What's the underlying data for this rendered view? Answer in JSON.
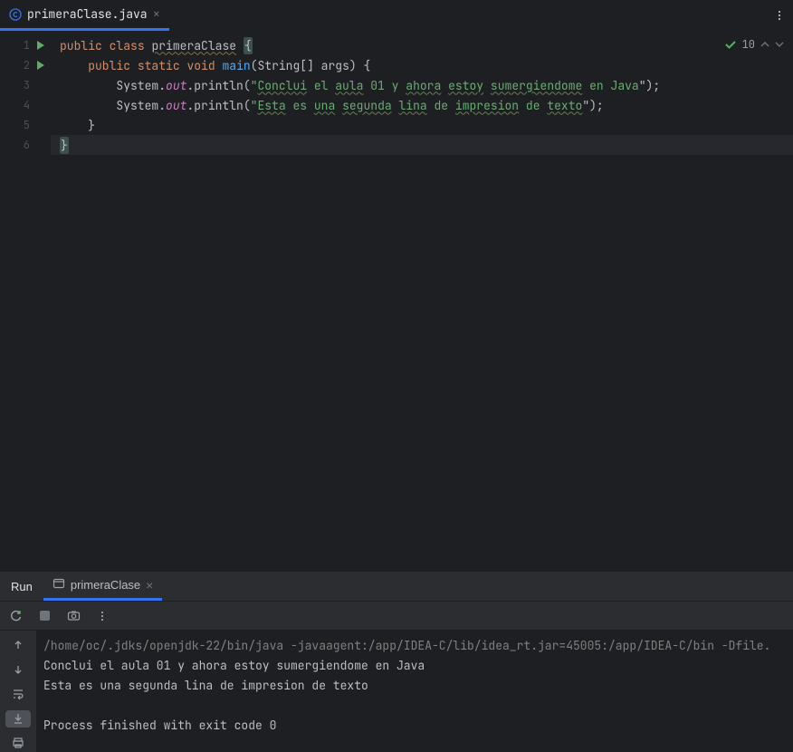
{
  "tab": {
    "filename": "primeraClase.java"
  },
  "inspections": {
    "count": "10"
  },
  "code": {
    "l1": {
      "kw1": "public",
      "kw2": "class",
      "name": "primeraClase",
      "brace": "{"
    },
    "l2": {
      "indent": "    ",
      "kw1": "public",
      "kw2": "static",
      "kw3": "void",
      "name": "main",
      "args": "(String[] args) {"
    },
    "l3": {
      "indent": "        ",
      "sys": "System.",
      "out": "out",
      "print": ".println(",
      "q": "\"",
      "w1": "Conclui",
      "s1": " el ",
      "w2": "aula",
      "s2": " 01 y ",
      "w3": "ahora",
      "s3": " ",
      "w4": "estoy",
      "s4": " ",
      "w5": "sumergiendome",
      "s5": " en Java",
      "end": "\");"
    },
    "l4": {
      "indent": "        ",
      "sys": "System.",
      "out": "out",
      "print": ".println(",
      "q": "\"",
      "w1": "Esta",
      "s1": " es ",
      "w2": "una",
      "s2": " ",
      "w3": "segunda",
      "s3": " ",
      "w4": "lina",
      "s4": " de ",
      "w5": "impresion",
      "s5": " de ",
      "w6": "texto",
      "end": "\");"
    },
    "l5": {
      "indent": "    ",
      "brace": "}"
    },
    "l6": {
      "brace": "}"
    }
  },
  "gutter": {
    "1": "1",
    "2": "2",
    "3": "3",
    "4": "4",
    "5": "5",
    "6": "6"
  },
  "run": {
    "label": "Run",
    "tab_name": "primeraClase"
  },
  "console": {
    "cmd": "/home/oc/.jdks/openjdk-22/bin/java -javaagent:/app/IDEA-C/lib/idea_rt.jar=45005:/app/IDEA-C/bin -Dfile.",
    "out1": "Conclui el aula 01 y ahora estoy sumergiendome en Java",
    "out2": "Esta es una segunda lina de impresion de texto",
    "blank": "",
    "exit": "Process finished with exit code 0"
  }
}
